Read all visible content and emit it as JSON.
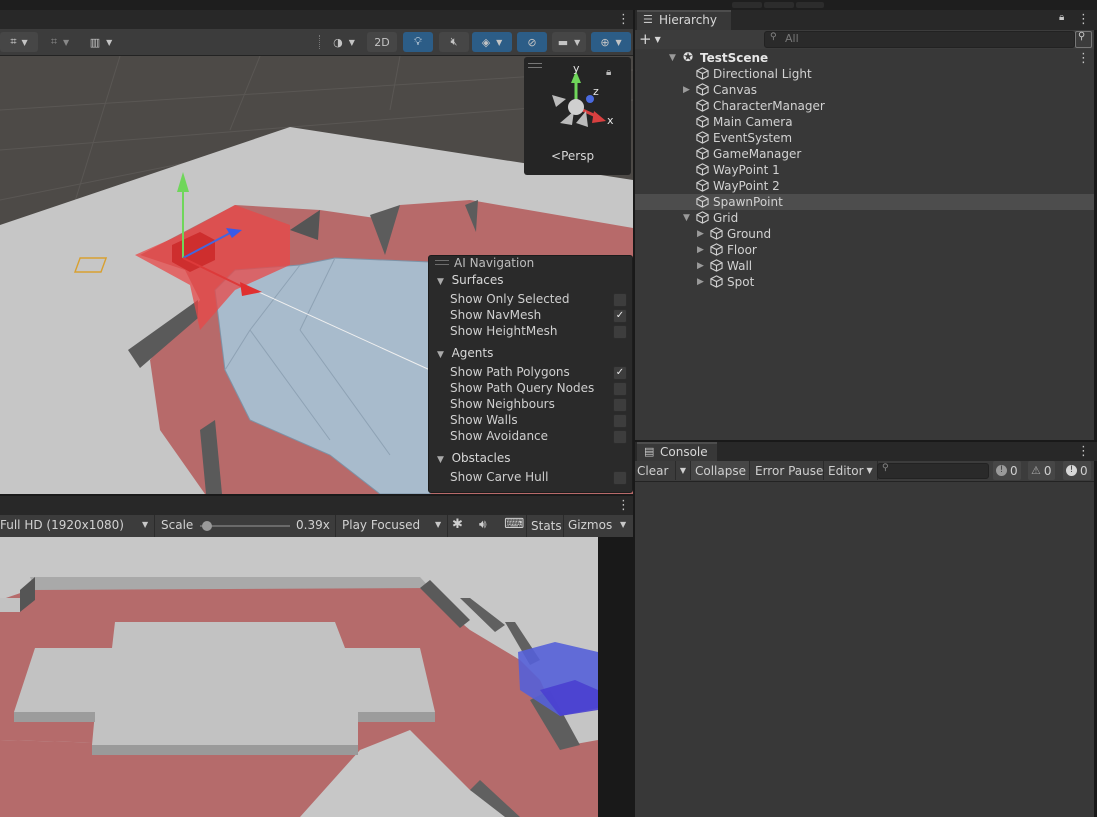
{
  "scene_toolbar": {
    "mode_2d_label": "2D"
  },
  "view_gizmo": {
    "axis_y": "y",
    "axis_z": "z",
    "axis_x": "x",
    "projection_label": "Persp"
  },
  "ai_navigation": {
    "title": "AI Navigation",
    "sections": [
      {
        "label": "Surfaces",
        "items": [
          {
            "label": "Show Only Selected",
            "checked": false
          },
          {
            "label": "Show NavMesh",
            "checked": true
          },
          {
            "label": "Show HeightMesh",
            "checked": false
          }
        ]
      },
      {
        "label": "Agents",
        "items": [
          {
            "label": "Show Path Polygons",
            "checked": true
          },
          {
            "label": "Show Path Query Nodes",
            "checked": false
          },
          {
            "label": "Show Neighbours",
            "checked": false
          },
          {
            "label": "Show Walls",
            "checked": false
          },
          {
            "label": "Show Avoidance",
            "checked": false
          }
        ]
      },
      {
        "label": "Obstacles",
        "items": [
          {
            "label": "Show Carve Hull",
            "checked": false
          }
        ]
      }
    ]
  },
  "game_toolbar": {
    "resolution": "Full HD (1920x1080)",
    "scale_label": "Scale",
    "scale_value": "0.39x",
    "scale_slider_fraction": 0.02,
    "play_mode": "Play Focused",
    "stats_label": "Stats",
    "gizmos_label": "Gizmos"
  },
  "hierarchy": {
    "tab_label": "Hierarchy",
    "search_placeholder": "All",
    "scene_name": "TestScene",
    "items": [
      {
        "label": "Directional Light",
        "depth": 1,
        "expandable": false
      },
      {
        "label": "Canvas",
        "depth": 1,
        "expandable": true
      },
      {
        "label": "CharacterManager",
        "depth": 1,
        "expandable": false
      },
      {
        "label": "Main Camera",
        "depth": 1,
        "expandable": false
      },
      {
        "label": "EventSystem",
        "depth": 1,
        "expandable": false
      },
      {
        "label": "GameManager",
        "depth": 1,
        "expandable": false
      },
      {
        "label": "WayPoint 1",
        "depth": 1,
        "expandable": false
      },
      {
        "label": "WayPoint 2",
        "depth": 1,
        "expandable": false
      },
      {
        "label": "SpawnPoint",
        "depth": 1,
        "expandable": false,
        "selected": true
      },
      {
        "label": "Grid",
        "depth": 1,
        "expandable": true,
        "expanded": true
      },
      {
        "label": "Ground",
        "depth": 2,
        "expandable": true
      },
      {
        "label": "Floor",
        "depth": 2,
        "expandable": true
      },
      {
        "label": "Wall",
        "depth": 2,
        "expandable": true
      },
      {
        "label": "Spot",
        "depth": 2,
        "expandable": true
      }
    ]
  },
  "console": {
    "tab_label": "Console",
    "clear_label": "Clear",
    "collapse_label": "Collapse",
    "error_pause_label": "Error Pause",
    "editor_label": "Editor",
    "info_count": "0",
    "warning_count": "0",
    "error_count": "0"
  },
  "colors": {
    "panel_bg": "#383838",
    "toolbar_bg": "#3c3c3c",
    "selection": "#4d4d4d",
    "toggle_active": "#2c5d87",
    "navmesh_area": "#b96a6a",
    "path_polygon": "#a9bccd"
  }
}
